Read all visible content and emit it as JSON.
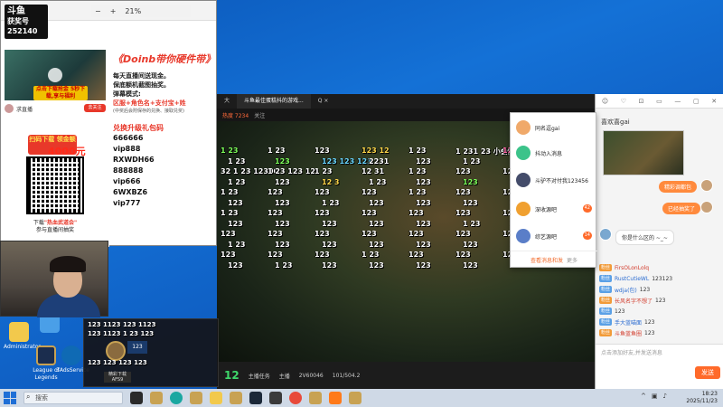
{
  "taskbar": {
    "search_placeholder": "搜索",
    "time": "18:23",
    "date": "2025/11/23"
  },
  "zoom": {
    "level": "21%",
    "minus": "−",
    "plus": "+"
  },
  "desktop": {
    "icons": [
      {
        "label": "Administrator"
      },
      {
        "label": "League of Legends"
      },
      {
        "label": "3AdsService"
      }
    ]
  },
  "promo": {
    "logo_line1": "斗鱼",
    "logo_line2": "获奖号",
    "logo_line3": "252140",
    "download_btn": "点击下载抢金 5秒下载,享与福利",
    "streamer_tag": "求直播",
    "cta": "去关注",
    "banner": "扫码下载 领金额",
    "amount": "4000元",
    "caption_line1": "下载",
    "caption_highlight": "\"热血武道会\"",
    "caption_line2": "参与直播间抽奖",
    "title": "《Doinb带你硬件带》",
    "line1": "每天直播间送现金。",
    "line2": "保底额机截图抽奖。",
    "line3": "弹幕模式:",
    "line4": "区服+角色名+支付宝+姓",
    "line5": "(中奖后会附保存的兑换、接取兑奖)",
    "codes_title": "兑换升级礼包码",
    "codes": [
      "666666",
      "vip888",
      "RXWDH66",
      "888888",
      "vip666",
      "6WXBZ6",
      "vip777"
    ]
  },
  "room": {
    "tabs": [
      "大",
      "斗鱼最佳蛋糕抖的游戏...",
      "Q ×"
    ],
    "hot": "热度 7234",
    "info2": "关注",
    "bottom_count": "12",
    "bottom_label": "主播任务",
    "bottom_items": [
      "主播",
      "2V60046",
      "101/504.2"
    ],
    "danmaku": [
      {
        "t": "1 23",
        "c": "#7dff5a"
      },
      {
        "t": "1 23",
        "c": "#ffffff"
      },
      {
        "t": "123",
        "c": "#ffffff"
      },
      {
        "t": "123 12",
        "c": "#ffd84a"
      },
      {
        "t": "1 23",
        "c": "#ffffff"
      },
      {
        "t": "1 231 23 小会终于要是了,赶紧",
        "c": "#ffffff"
      },
      {
        "t": "123",
        "c": "#ff6aa8"
      },
      {
        "t": "123",
        "c": "#ffffff"
      },
      {
        "t": "1 23",
        "c": "#ffffff"
      },
      {
        "t": "123",
        "c": "#7dff5a"
      },
      {
        "t": "123 123 123",
        "c": "#6ad7ff"
      },
      {
        "t": "2231",
        "c": "#ffffff"
      },
      {
        "t": "123",
        "c": "#ffffff"
      },
      {
        "t": "1 23",
        "c": "#ffffff"
      },
      {
        "t": "1233 1 23",
        "c": "#ffffff"
      },
      {
        "t": "1231",
        "c": "#ffffff"
      },
      {
        "t": "32 1 23 12300",
        "c": "#ffffff"
      },
      {
        "t": "1 23 123 12",
        "c": "#ffffff"
      },
      {
        "t": "1 23",
        "c": "#ffffff"
      },
      {
        "t": "12 31",
        "c": "#ffffff"
      },
      {
        "t": "1 23",
        "c": "#ffffff"
      },
      {
        "t": "123",
        "c": "#ffffff"
      },
      {
        "t": "123 123 123",
        "c": "#ffffff"
      },
      {
        "t": "123",
        "c": "#ffffff"
      },
      {
        "t": "1 23",
        "c": "#ffffff"
      },
      {
        "t": "123",
        "c": "#ffffff"
      },
      {
        "t": "12 3",
        "c": "#ffd84a"
      },
      {
        "t": "1 23",
        "c": "#ffffff"
      },
      {
        "t": "123",
        "c": "#ffffff"
      },
      {
        "t": "123",
        "c": "#7dff5a"
      },
      {
        "t": "12 3",
        "c": "#ffffff"
      },
      {
        "t": "123",
        "c": "#ffffff"
      },
      {
        "t": "1 23",
        "c": "#ffffff"
      },
      {
        "t": "123",
        "c": "#ffffff"
      },
      {
        "t": "123",
        "c": "#ffffff"
      },
      {
        "t": "123",
        "c": "#ffffff"
      },
      {
        "t": "1 23",
        "c": "#ffffff"
      },
      {
        "t": "123",
        "c": "#ffffff"
      },
      {
        "t": "123",
        "c": "#ffffff"
      },
      {
        "t": "123",
        "c": "#ffffff"
      },
      {
        "t": "123",
        "c": "#ffffff"
      },
      {
        "t": "123",
        "c": "#ffffff"
      },
      {
        "t": "1 23",
        "c": "#ffffff"
      },
      {
        "t": "123",
        "c": "#ffffff"
      },
      {
        "t": "123",
        "c": "#ffffff"
      },
      {
        "t": "123",
        "c": "#ffffff"
      },
      {
        "t": "123",
        "c": "#ffffff"
      },
      {
        "t": "123",
        "c": "#ffffff"
      },
      {
        "t": "1 23",
        "c": "#ffffff"
      },
      {
        "t": "123",
        "c": "#ffffff"
      },
      {
        "t": "123",
        "c": "#ffffff"
      },
      {
        "t": "123",
        "c": "#ffffff"
      },
      {
        "t": "123",
        "c": "#ffffff"
      },
      {
        "t": "123",
        "c": "#ffffff"
      },
      {
        "t": "123",
        "c": "#ffffff"
      },
      {
        "t": "1 23",
        "c": "#ffffff"
      },
      {
        "t": "123",
        "c": "#ffffff"
      },
      {
        "t": "123",
        "c": "#ffffff"
      },
      {
        "t": "123",
        "c": "#ffffff"
      },
      {
        "t": "123",
        "c": "#ffffff"
      },
      {
        "t": "123",
        "c": "#ffffff"
      },
      {
        "t": "1 23",
        "c": "#ffffff"
      },
      {
        "t": "123",
        "c": "#ffffff"
      },
      {
        "t": "123",
        "c": "#ffffff"
      },
      {
        "t": "123",
        "c": "#ffffff"
      },
      {
        "t": "123",
        "c": "#ffffff"
      },
      {
        "t": "123",
        "c": "#ffffff"
      },
      {
        "t": "123",
        "c": "#ffffff"
      },
      {
        "t": "123",
        "c": "#ffffff"
      },
      {
        "t": "123",
        "c": "#ffffff"
      },
      {
        "t": "123",
        "c": "#ffffff"
      },
      {
        "t": "123",
        "c": "#ffffff"
      },
      {
        "t": "1 23",
        "c": "#ffffff"
      },
      {
        "t": "123",
        "c": "#ffffff"
      },
      {
        "t": "123",
        "c": "#ffffff"
      },
      {
        "t": "123",
        "c": "#ffffff"
      },
      {
        "t": "123",
        "c": "#ffffff"
      },
      {
        "t": "123",
        "c": "#ffffff"
      },
      {
        "t": "123",
        "c": "#ffffff"
      },
      {
        "t": "123",
        "c": "#ffffff"
      },
      {
        "t": "123",
        "c": "#ffffff"
      },
      {
        "t": "123",
        "c": "#ffffff"
      },
      {
        "t": "123",
        "c": "#ffffff"
      },
      {
        "t": "1 23",
        "c": "#ffffff"
      },
      {
        "t": "123",
        "c": "#ffffff"
      },
      {
        "t": "123",
        "c": "#ffffff"
      },
      {
        "t": "123",
        "c": "#ffffff"
      },
      {
        "t": "123",
        "c": "#ffffff"
      },
      {
        "t": "123",
        "c": "#ffffff"
      },
      {
        "t": "1 23",
        "c": "#ffffff"
      },
      {
        "t": "123",
        "c": "#ffffff"
      },
      {
        "t": "123",
        "c": "#ffffff"
      },
      {
        "t": "123",
        "c": "#ffffff"
      },
      {
        "t": "123",
        "c": "#ffffff"
      }
    ]
  },
  "game": {
    "rows": [
      "123  1123  123  1123",
      "123  1123  1 23  123",
      "123  123 1123  123",
      "1 23  1 23  1 23",
      "123  123  123  123",
      "3  123  123  123"
    ],
    "level": "123",
    "label": "精彩下载 AFS9"
  },
  "chat": {
    "head_items": [
      "☺",
      "♡",
      "⊡",
      "▭",
      "—",
      "▢",
      "✕"
    ],
    "user": "喜欢喜gai ",
    "bubble1": "精彩调都包",
    "bubble2": "已经抽奖了",
    "bubble3": "你是什么区的 ~_~",
    "input_placeholder": "点击添加好友,并发送消息",
    "send": "发送",
    "danmaku": [
      {
        "badge": "粉丝",
        "name": "FirsOLonLolq",
        "text": "",
        "color": "o"
      },
      {
        "badge": "粉丝",
        "name": "RustCutieWL",
        "text": "123123",
        "color": ""
      },
      {
        "badge": "粉丝",
        "name": "wdja(包)",
        "text": "123",
        "color": ""
      },
      {
        "badge": "粉丝",
        "name": "长风名字不想了",
        "text": "123",
        "color": "o"
      },
      {
        "badge": "粉丝",
        "name": "",
        "text": "123",
        "color": ""
      },
      {
        "badge": "粉丝",
        "name": "手大蓝喵面",
        "text": "123",
        "color": ""
      },
      {
        "badge": "粉丝",
        "name": "斗鱼蓝鱼圈",
        "text": "123",
        "color": "o"
      }
    ]
  },
  "contacts": {
    "items": [
      {
        "name": "同名逗gai",
        "badge": "",
        "color": "#f0a96a"
      },
      {
        "name": "抖动入消息",
        "badge": "",
        "color": "#3cc38a"
      },
      {
        "name": "斗驴不对付我123456",
        "badge": "",
        "color": "#444c6a"
      },
      {
        "name": "深收源吧",
        "badge": "42",
        "color": "#f0a030"
      },
      {
        "name": "综艺源吧",
        "badge": "14",
        "color": "#5a7ec8"
      }
    ],
    "footer": "查看消息和发",
    "footer_sub": "更多"
  }
}
